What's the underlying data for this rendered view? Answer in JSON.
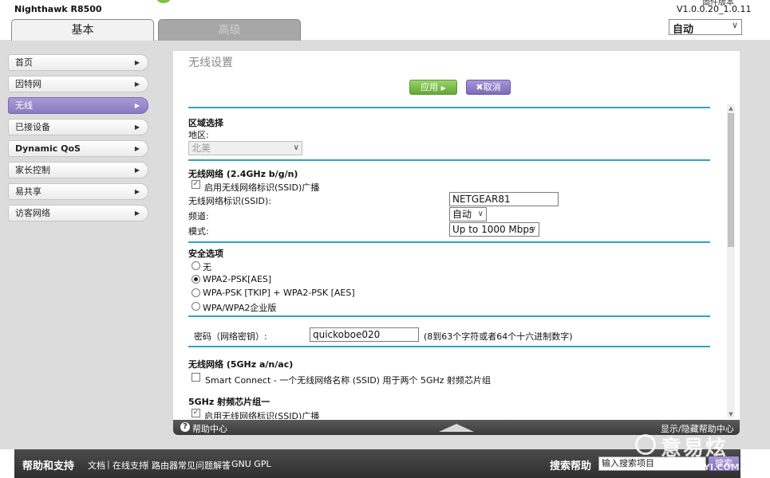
{
  "header": {
    "product": "Nighthawk R8500",
    "firmware_label": "固件版本",
    "firmware": "V1.0.0.20_1.0.11",
    "language": "自动",
    "tabs": {
      "basic": "基本",
      "advanced": "高级"
    }
  },
  "sidebar": {
    "items": [
      {
        "label": "首页"
      },
      {
        "label": "因特网"
      },
      {
        "label": "无线"
      },
      {
        "label": "已接设备"
      },
      {
        "label": "Dynamic QoS"
      },
      {
        "label": "家长控制"
      },
      {
        "label": "易共享"
      },
      {
        "label": "访客网络"
      }
    ]
  },
  "page": {
    "title": "无线设置",
    "apply": "应用",
    "cancel": "取消"
  },
  "region": {
    "title": "区域选择",
    "label": "地区:",
    "value": "北美"
  },
  "wifi24": {
    "title": "无线网络 (2.4GHz b/g/n)",
    "broadcast_label": "启用无线网络标识(SSID)广播",
    "ssid_label": "无线网络标识(SSID):",
    "ssid_value": "NETGEAR81",
    "channel_label": "频道:",
    "channel_value": "自动",
    "mode_label": "模式:",
    "mode_value": "Up to 1000 Mbps"
  },
  "security": {
    "title": "安全选项",
    "options": [
      "无",
      "WPA2-PSK[AES]",
      "WPA-PSK [TKIP] + WPA2-PSK [AES]",
      "WPA/WPA2企业版"
    ],
    "password_label": "密码（网络密钥）:",
    "password_value": "quickoboe020",
    "password_hint": "(8到63个字符或者64个十六进制数字)"
  },
  "wifi5": {
    "title": "无线网络 (5GHz a/n/ac)",
    "smart_connect": "Smart Connect - 一个无线网络名称 (SSID) 用于两个 5GHz 射频芯片组",
    "group_title": "5GHz 射频芯片组一",
    "broadcast_label": "启用无线网络标识(SSID)广播"
  },
  "helpbar": {
    "help_center": "帮助中心",
    "toggle": "显示/隐藏帮助中心"
  },
  "footer": {
    "title": "帮助和支持",
    "links": [
      "文档",
      "在线支持",
      "路由器常见问题解答",
      "GNU GPL"
    ],
    "search_label": "搜索帮助",
    "search_placeholder": "输入搜索项目",
    "search_button": "搜索"
  },
  "watermark": {
    "line1": "意易炫",
    "line2": "YIYI.COM.CN"
  }
}
